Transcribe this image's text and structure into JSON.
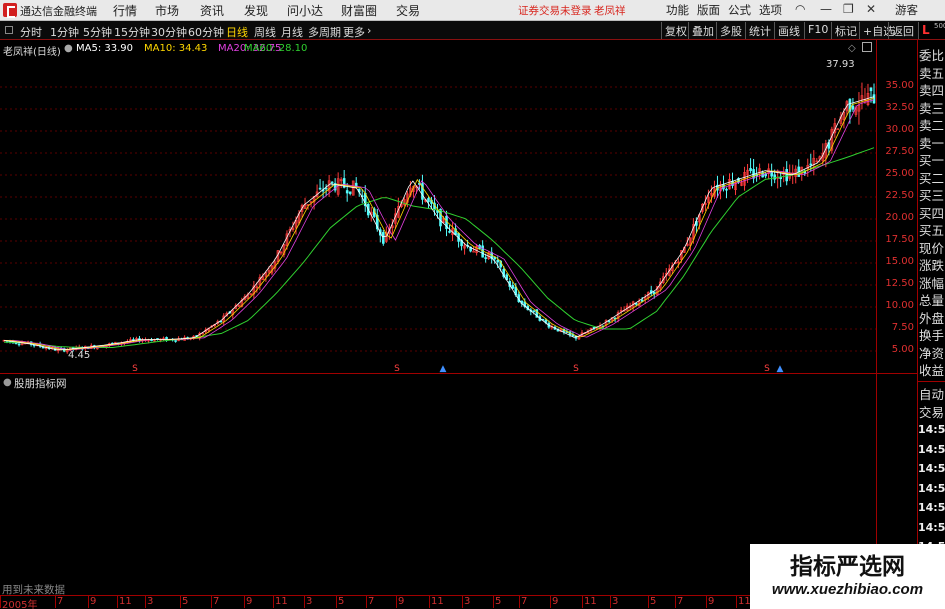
{
  "app": {
    "title": "通达信金融终端",
    "main_menu": [
      "行情",
      "市场",
      "资讯",
      "发现",
      "问小达",
      "财富圈",
      "交易"
    ],
    "warning": "证券交易未登录",
    "stock_short": "老凤祥",
    "right_menu": [
      "功能",
      "版面",
      "公式",
      "选项"
    ],
    "guest": "游客"
  },
  "toolbar": {
    "periods": [
      "分时",
      "1分钟",
      "5分钟",
      "15分钟",
      "30分钟",
      "60分钟",
      "日线",
      "周线",
      "月线",
      "多周期",
      "更多"
    ],
    "active_period": "日线",
    "more_arrow": "›",
    "right_buttons": [
      "复权",
      "叠加",
      "多股",
      "统计",
      "画线",
      "F10",
      "标记",
      "+自选",
      "返回"
    ]
  },
  "chart": {
    "title": "老凤祥(日线)",
    "ma": [
      {
        "label": "MA5: 33.90",
        "color": "#ffffff"
      },
      {
        "label": "MA10: 34.43",
        "color": "#ffd700"
      },
      {
        "label": "MA20: 32.75",
        "color": "#e040e0"
      },
      {
        "label": "MA60: 28.10",
        "color": "#30d030"
      }
    ],
    "max_label": "37.93",
    "min_label": "4.45",
    "y_ticks": [
      "35.00",
      "32.50",
      "30.00",
      "27.50",
      "25.00",
      "22.50",
      "20.00",
      "17.50",
      "15.00",
      "12.50",
      "10.00",
      "7.50",
      "5.00"
    ],
    "markers": {
      "s": "S",
      "b": "▲"
    }
  },
  "sub_panel": {
    "title": "股朋指标网",
    "footer": "用到未来数据"
  },
  "x_labels": [
    "2005年",
    "7",
    "9",
    "11",
    "3",
    "5",
    "7",
    "9",
    "11",
    "3",
    "5",
    "7",
    "9",
    "11",
    "3",
    "5",
    "7",
    "9",
    "11",
    "3",
    "5",
    "7",
    "9",
    "11",
    "3",
    "5"
  ],
  "sidebar": {
    "header_letter": "L",
    "header_num": "500",
    "items": [
      "委比",
      "卖五",
      "卖四",
      "卖三",
      "卖二",
      "卖一",
      "买一",
      "买二",
      "买三",
      "买四",
      "买五",
      "现价",
      "涨跌",
      "涨幅",
      "总量",
      "外盘",
      "换手",
      "净资",
      "收益"
    ],
    "lower": [
      "自动",
      "交易"
    ],
    "times": [
      "14:56",
      "14:56",
      "14:56",
      "14:56",
      "14:56",
      "14:56",
      "14:56",
      "14:56"
    ]
  },
  "chart_data": {
    "type": "line",
    "series": [
      {
        "name": "MA60",
        "values": [
          6.0,
          5.9,
          5.5,
          5.4,
          5.4,
          5.8,
          6.2,
          6.5,
          7.0,
          8.5,
          11.5,
          15.0,
          19.0,
          21.5,
          22.5,
          21.5,
          21.0,
          20.0,
          17.5,
          14.5,
          11.0,
          8.5,
          7.5,
          7.5,
          9.5,
          13.5,
          18.5,
          22.5,
          24.5,
          25.0,
          26.0,
          27.0,
          28.1
        ]
      },
      {
        "name": "MA5",
        "values": [
          6.2,
          5.8,
          5.1,
          5.4,
          5.8,
          6.3,
          6.3,
          6.5,
          8.5,
          11.5,
          15.5,
          21.5,
          24.0,
          23.5,
          17.5,
          24.5,
          20.0,
          17.0,
          15.5,
          10.5,
          8.0,
          6.5,
          8.0,
          10.0,
          12.0,
          16.5,
          23.5,
          24.5,
          25.5,
          25.0,
          26.5,
          33.0,
          33.9
        ]
      }
    ],
    "ylim": [
      3.5,
      38
    ]
  },
  "watermark": {
    "line1": "指标严选网",
    "line2": "www.xuezhibiao.com"
  }
}
